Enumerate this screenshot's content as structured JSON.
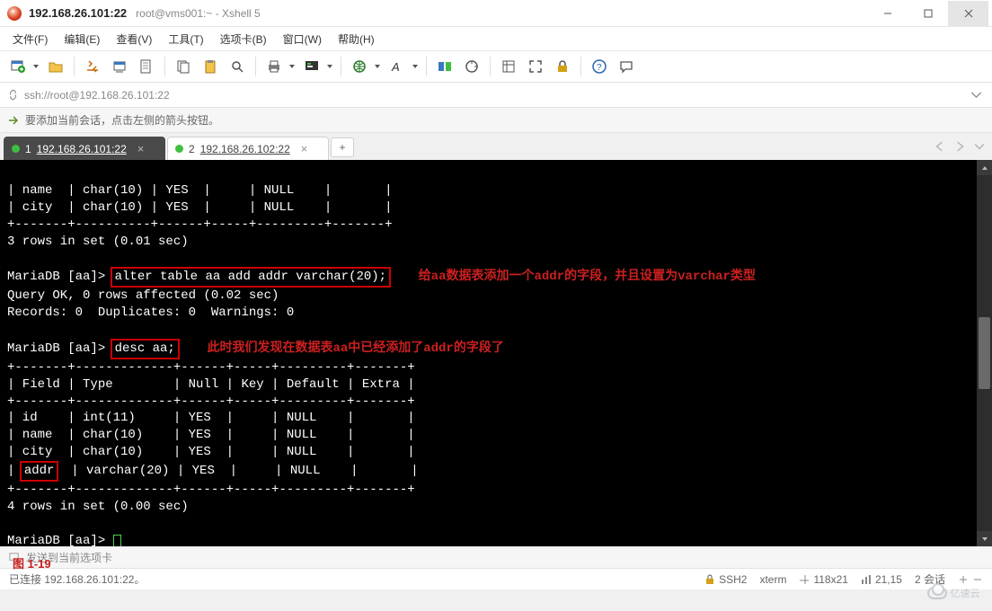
{
  "title": {
    "main": "192.168.26.101:22",
    "sub": "root@vms001:~ - Xshell 5"
  },
  "menu": {
    "file": "文件(F)",
    "edit": "编辑(E)",
    "view": "查看(V)",
    "tools": "工具(T)",
    "tabs": "选项卡(B)",
    "window": "窗口(W)",
    "help": "帮助(H)"
  },
  "address_bar": {
    "url": "ssh://root@192.168.26.101:22"
  },
  "info_bar": {
    "text": "要添加当前会话，点击左侧的箭头按钮。"
  },
  "tabs": {
    "t1_num": "1",
    "t1_label": "192.168.26.101:22",
    "t2_num": "2",
    "t2_label": "192.168.26.102:22"
  },
  "terminal": {
    "head_rows": "| name  | char(10) | YES  |     | NULL    |       |\n| city  | char(10) | YES  |     | NULL    |       |\n+-------+----------+------+-----+---------+-------+",
    "rows_msg_1": "3 rows in set (0.01 sec)",
    "prompt": "MariaDB [aa]>",
    "cmd_alter": "alter table aa add addr varchar(20);",
    "ann_alter": "给aa数据表添加一个addr的字段，并且设置为varchar类型",
    "query_ok": "Query OK, 0 rows affected (0.02 sec)",
    "records": "Records: 0  Duplicates: 0  Warnings: 0",
    "cmd_desc": "desc aa;",
    "ann_desc": "此时我们发现在数据表aa中已经添加了addr的字段了",
    "sep": "+-------+-------------+------+-----+---------+-------+",
    "header": "| Field | Type        | Null | Key | Default | Extra |",
    "r_id": "| id    | int(11)     | YES  |     | NULL    |       |",
    "r_name": "| name  | char(10)    | YES  |     | NULL    |       |",
    "r_city": "| city  | char(10)    | YES  |     | NULL    |       |",
    "r_addr_pre": "| ",
    "r_addr_field": "addr",
    "r_addr_post": "  | varchar(20) | YES  |     | NULL    |       |",
    "rows_msg_2": "4 rows in set (0.00 sec)"
  },
  "figure_label": "图 1-19",
  "hint_bar": {
    "text": "发送到当前选项卡"
  },
  "status": {
    "connected": "已连接 192.168.26.101:22。",
    "proto": "SSH2",
    "term": "xterm",
    "size": "118x21",
    "cursor": "21,15",
    "sessions": "2 会话"
  },
  "watermark": "亿速云"
}
